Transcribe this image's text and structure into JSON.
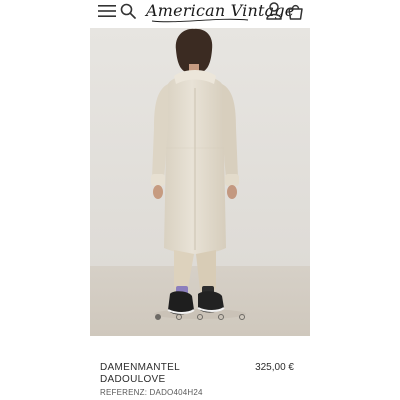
{
  "header": {
    "brand": "American Vintage",
    "icons": [
      "menu-icon",
      "search-icon",
      "account-icon",
      "bag-icon"
    ]
  },
  "gallery": {
    "image_count": 5,
    "active_index": 0,
    "image_subject": "model wearing long beige wool coat, back view"
  },
  "product": {
    "name_line1": "DAMENMANTEL",
    "name_line2": "DADOULOVE",
    "price": "325,00 €",
    "reference": "REFERENZ: DADO404H24"
  },
  "colors": {
    "background": "#ffffff",
    "studio_wall": "#e4e1dc",
    "coat": "#e3dccd",
    "text": "#2d2d2d"
  }
}
